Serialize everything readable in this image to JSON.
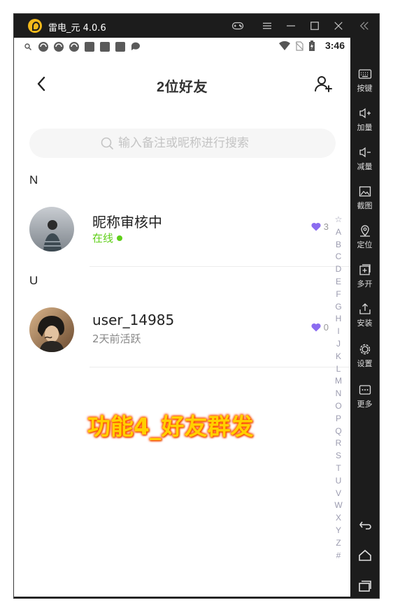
{
  "window": {
    "app_title": "雷电_元 4.0.6"
  },
  "statusbar": {
    "time": "3:46"
  },
  "navbar": {
    "title": "2位好友"
  },
  "search": {
    "placeholder": "输入备注或昵称进行搜索"
  },
  "sections": [
    {
      "letter": "N",
      "friend": {
        "name": "昵称审核中",
        "status": "在线",
        "status_color": "#5fcf19",
        "likes": "3"
      }
    },
    {
      "letter": "U",
      "friend": {
        "name": "user_14985",
        "status": "2天前活跃",
        "status_color": "#888888",
        "likes": "0"
      }
    }
  ],
  "index_letters": [
    "☆",
    "A",
    "B",
    "C",
    "D",
    "E",
    "F",
    "G",
    "H",
    "I",
    "J",
    "K",
    "L",
    "M",
    "N",
    "O",
    "P",
    "Q",
    "R",
    "S",
    "T",
    "U",
    "V",
    "W",
    "X",
    "Y",
    "Z",
    "#"
  ],
  "overlay_caption": "功能4_好友群发",
  "side_toolbar": {
    "items": [
      {
        "label": "按键",
        "icon": "keyboard-icon"
      },
      {
        "label": "加量",
        "icon": "volume-up-icon"
      },
      {
        "label": "减量",
        "icon": "volume-down-icon"
      },
      {
        "label": "截图",
        "icon": "screenshot-icon"
      },
      {
        "label": "定位",
        "icon": "location-icon"
      },
      {
        "label": "多开",
        "icon": "multi-instance-icon"
      },
      {
        "label": "安装",
        "icon": "install-icon"
      },
      {
        "label": "设置",
        "icon": "settings-icon"
      },
      {
        "label": "更多",
        "icon": "more-icon"
      }
    ]
  },
  "colors": {
    "accent_heart": "#8b6cf0",
    "online": "#5fcf19",
    "caption_fill": "#ffd000",
    "caption_outline": "#ff5a00",
    "frame": "#1c1c1c"
  }
}
